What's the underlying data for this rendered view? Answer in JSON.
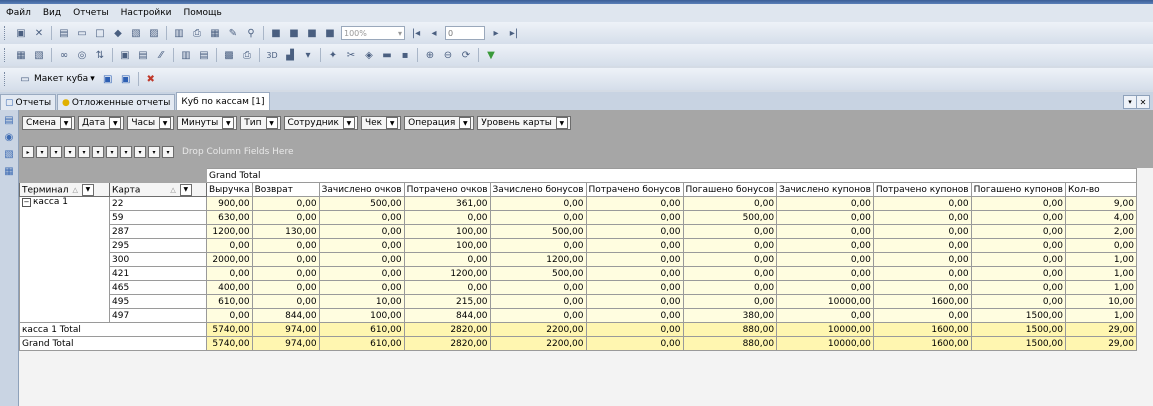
{
  "menu": [
    "Файл",
    "Вид",
    "Отчеты",
    "Настройки",
    "Помощь"
  ],
  "toolbar1": {
    "zoom": "100%",
    "page": "0"
  },
  "toolbar3": {
    "layout_label": "Макет куба"
  },
  "tabs": [
    {
      "label": "Отчеты",
      "icon": "report-icon"
    },
    {
      "label": "Отложенные отчеты",
      "icon": "bulb-icon"
    },
    {
      "label": "Куб по кассам [1]",
      "icon": ""
    }
  ],
  "filters": [
    "Смена",
    "Дата",
    "Часы",
    "Минуты",
    "Тип",
    "Сотрудник",
    "Чек",
    "Операция",
    "Уровень карты"
  ],
  "drop_column_text": "Drop Column Fields Here",
  "grand_total_header": "Grand Total",
  "row_fields": [
    "Терминал",
    "Карта"
  ],
  "columns": [
    "Выручка",
    "Возврат",
    "Зачислено очков",
    "Потрачено очков",
    "Зачислено бонусов",
    "Потрачено бонусов",
    "Погашено бонусов",
    "Зачислено купонов",
    "Потрачено купонов",
    "Погашено купонов",
    "Кол-во"
  ],
  "group_label": "касса 1",
  "rows": [
    {
      "card": "22",
      "values": [
        "900,00",
        "0,00",
        "500,00",
        "361,00",
        "0,00",
        "0,00",
        "0,00",
        "0,00",
        "0,00",
        "0,00",
        "9,00"
      ]
    },
    {
      "card": "59",
      "values": [
        "630,00",
        "0,00",
        "0,00",
        "0,00",
        "0,00",
        "0,00",
        "500,00",
        "0,00",
        "0,00",
        "0,00",
        "4,00"
      ]
    },
    {
      "card": "287",
      "values": [
        "1200,00",
        "130,00",
        "0,00",
        "100,00",
        "500,00",
        "0,00",
        "0,00",
        "0,00",
        "0,00",
        "0,00",
        "2,00"
      ]
    },
    {
      "card": "295",
      "values": [
        "0,00",
        "0,00",
        "0,00",
        "100,00",
        "0,00",
        "0,00",
        "0,00",
        "0,00",
        "0,00",
        "0,00",
        "0,00"
      ]
    },
    {
      "card": "300",
      "values": [
        "2000,00",
        "0,00",
        "0,00",
        "0,00",
        "1200,00",
        "0,00",
        "0,00",
        "0,00",
        "0,00",
        "0,00",
        "1,00"
      ]
    },
    {
      "card": "421",
      "values": [
        "0,00",
        "0,00",
        "0,00",
        "1200,00",
        "500,00",
        "0,00",
        "0,00",
        "0,00",
        "0,00",
        "0,00",
        "1,00"
      ]
    },
    {
      "card": "465",
      "values": [
        "400,00",
        "0,00",
        "0,00",
        "0,00",
        "0,00",
        "0,00",
        "0,00",
        "0,00",
        "0,00",
        "0,00",
        "1,00"
      ]
    },
    {
      "card": "495",
      "values": [
        "610,00",
        "0,00",
        "10,00",
        "215,00",
        "0,00",
        "0,00",
        "0,00",
        "10000,00",
        "1600,00",
        "0,00",
        "10,00"
      ]
    },
    {
      "card": "497",
      "values": [
        "0,00",
        "844,00",
        "100,00",
        "844,00",
        "0,00",
        "0,00",
        "380,00",
        "0,00",
        "0,00",
        "1500,00",
        "1,00"
      ]
    }
  ],
  "group_total": {
    "label": "касса 1 Total",
    "values": [
      "5740,00",
      "974,00",
      "610,00",
      "2820,00",
      "2200,00",
      "0,00",
      "880,00",
      "10000,00",
      "1600,00",
      "1500,00",
      "29,00"
    ]
  },
  "grand_total": {
    "label": "Grand Total",
    "values": [
      "5740,00",
      "974,00",
      "610,00",
      "2820,00",
      "2200,00",
      "0,00",
      "880,00",
      "10000,00",
      "1600,00",
      "1500,00",
      "29,00"
    ]
  }
}
